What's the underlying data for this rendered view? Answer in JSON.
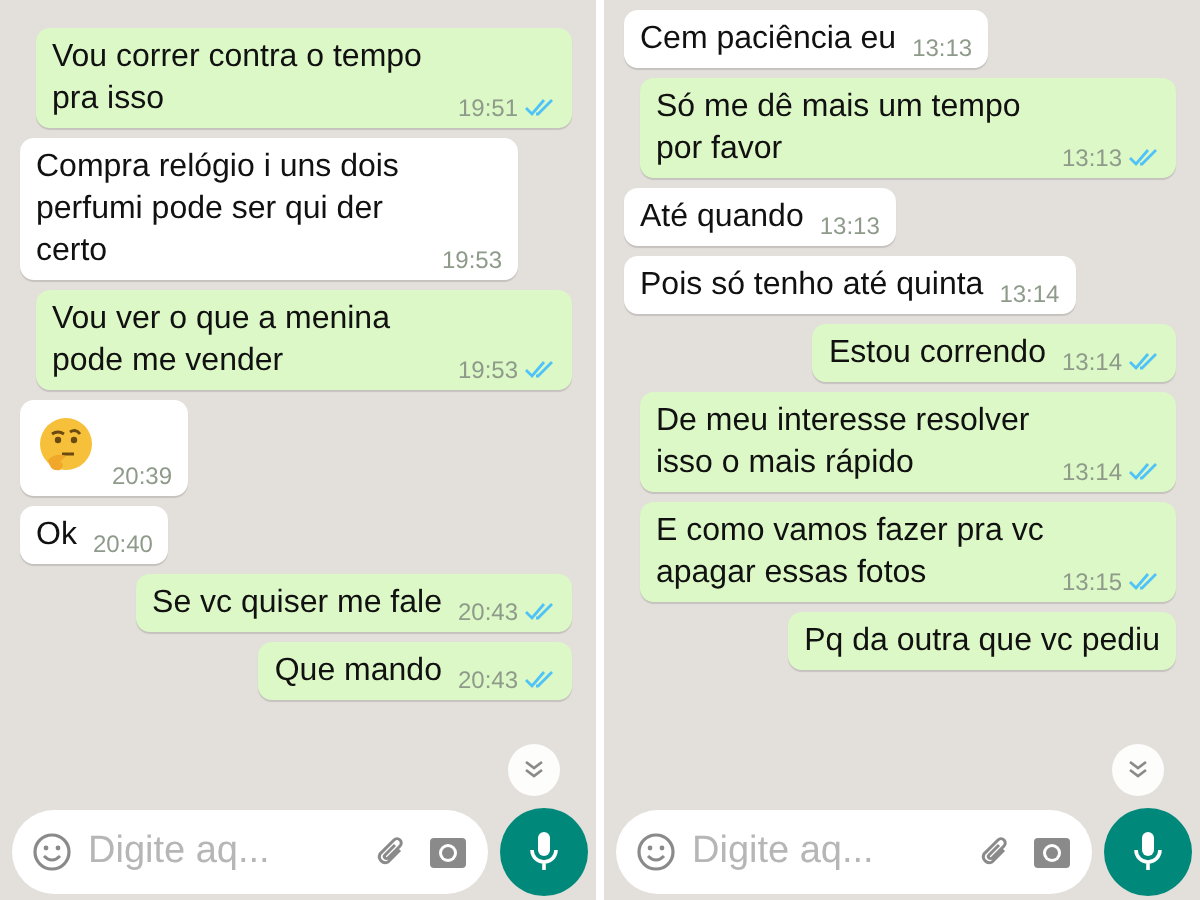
{
  "panels": [
    {
      "messages": [
        {
          "kind": "out",
          "text": "Vou correr contra o tempo pra isso",
          "time": "19:51",
          "read": true
        },
        {
          "kind": "in",
          "text": "Compra relógio i uns dois perfumi pode ser qui der certo",
          "time": "19:53"
        },
        {
          "kind": "out",
          "text": "Vou ver o que a menina pode me vender",
          "time": "19:53",
          "read": true
        },
        {
          "kind": "emoji",
          "time": "20:39"
        },
        {
          "kind": "in",
          "text": "Ok",
          "time": "20:40"
        },
        {
          "kind": "out",
          "text": "Se vc quiser me fale",
          "time": "20:43",
          "read": true
        },
        {
          "kind": "out",
          "text": "Que mando",
          "time": "20:43",
          "read": true
        }
      ],
      "input": {
        "placeholder": "Digite aq..."
      }
    },
    {
      "messages": [
        {
          "kind": "in",
          "text": "Cem paciência eu",
          "time": "13:13"
        },
        {
          "kind": "out",
          "text": "Só me dê mais um tempo por favor",
          "time": "13:13",
          "read": true
        },
        {
          "kind": "in",
          "text": "Até quando",
          "time": "13:13"
        },
        {
          "kind": "in",
          "text": "Pois só tenho até quinta",
          "time": "13:14"
        },
        {
          "kind": "out",
          "text": "Estou correndo",
          "time": "13:14",
          "read": true
        },
        {
          "kind": "out",
          "text": "De meu interesse resolver isso o mais rápido",
          "time": "13:14",
          "read": true
        },
        {
          "kind": "out",
          "text": "E como vamos fazer pra vc apagar essas fotos",
          "time": "13:15",
          "read": true
        },
        {
          "kind": "out",
          "text": "Pq da outra que vc pediu"
        }
      ],
      "input": {
        "placeholder": "Digite aq..."
      }
    }
  ]
}
